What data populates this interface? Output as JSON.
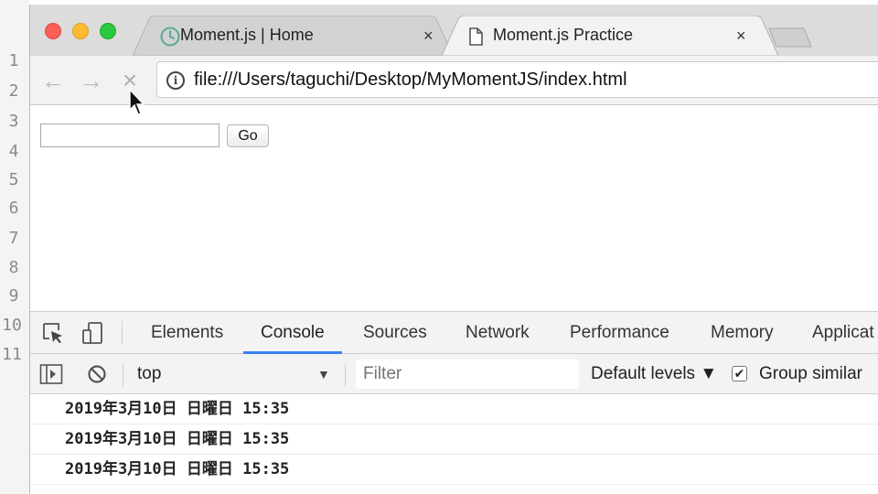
{
  "editor": {
    "line_numbers": [
      "1",
      "2",
      "3",
      "4",
      "5",
      "6",
      "7",
      "8",
      "9",
      "10",
      "11"
    ]
  },
  "browser": {
    "tabs": [
      {
        "title": "Moment.js | Home",
        "close": "×",
        "icon": "clock-icon",
        "active": false
      },
      {
        "title": "Moment.js Practice",
        "close": "×",
        "icon": "page-icon",
        "active": true
      }
    ],
    "toolbar": {
      "back": "←",
      "forward": "→",
      "stop": "×",
      "info_icon": "i",
      "url": "file:///Users/taguchi/Desktop/MyMomentJS/index.html"
    }
  },
  "page": {
    "input_value": "",
    "go_label": "Go"
  },
  "devtools": {
    "tabs": [
      "Elements",
      "Console",
      "Sources",
      "Network",
      "Performance",
      "Memory",
      "Applicat"
    ],
    "active_tab": "Console",
    "console_bar": {
      "context": "top",
      "context_arrow": "▼",
      "filter_placeholder": "Filter",
      "levels": "Default levels ▼",
      "group_checked": "✔",
      "group_label": "Group similar"
    },
    "logs": [
      "2019年3月10日 日曜日 15:35",
      "2019年3月10日 日曜日 15:35",
      "2019年3月10日 日曜日 15:35"
    ]
  },
  "colors": {
    "active_tab_underline": "#3a82f7",
    "traffic_red": "#fc5f57",
    "traffic_yellow": "#fdbc2e",
    "traffic_green": "#28c840"
  }
}
